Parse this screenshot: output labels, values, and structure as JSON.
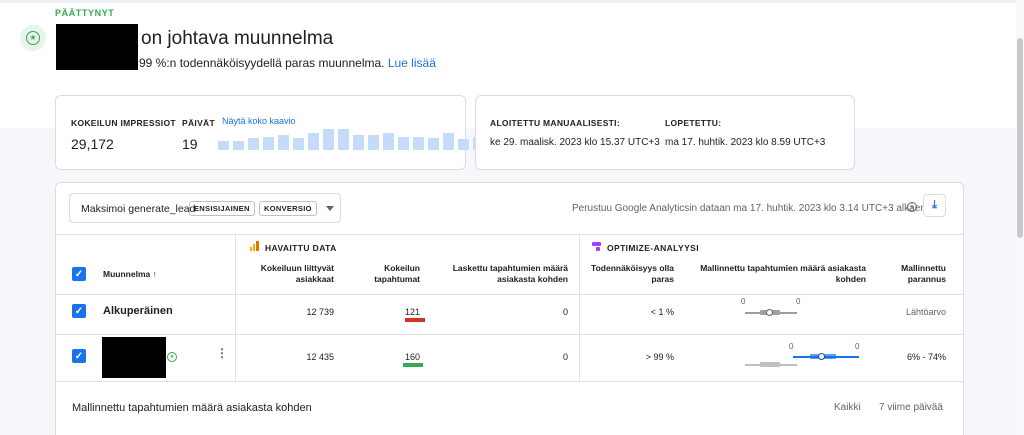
{
  "header": {
    "status": "PÄÄTTYNYT",
    "headline": "on johtava muunnelma",
    "subline": "99 %:n todennäköisyydellä paras muunnelma.",
    "learn_more": "Lue lisää"
  },
  "summary": {
    "impressions_label": "KOKEILUN IMPRESSIOT",
    "impressions_value": "29,172",
    "days_label": "PÄIVÄT",
    "days_value": "19",
    "show_chart_link": "Näytä koko kaavio",
    "days_chart_values": [
      0.4,
      0.4,
      0.55,
      0.6,
      0.7,
      0.55,
      0.75,
      0.95,
      0.95,
      0.7,
      0.7,
      0.75,
      0.6,
      0.6,
      0.55,
      0.75,
      0.5,
      0.6,
      0.75
    ],
    "started_label": "ALOITETTU MANUAALISESTI:",
    "started_value": "ke 29. maalisk. 2023 klo 15.37 UTC+3",
    "ended_label": "LOPETETTU:",
    "ended_value": "ma 17. huhtik. 2023 klo 8.59 UTC+3"
  },
  "toolbar": {
    "objective_label": "Maksimoi generate_lead",
    "chip_primary": "ENSISIJAINEN",
    "chip_conversion": "KONVERSIO",
    "based_on": "Perustuu Google Analyticsin dataan ma 17. huhtik. 2023 klo 3.14 UTC+3 alkaen.",
    "info_glyph": "i",
    "download_glyph": "⤓"
  },
  "table": {
    "observed_title": "HAVAITTU DATA",
    "optimize_title": "OPTIMIZE-ANALYYSI",
    "col_variant": "Muunnelma ↑",
    "col_users": [
      "Kokeiluun liittyvät",
      "asiakkaat"
    ],
    "col_events": [
      "Kokeilun",
      "tapahtumat"
    ],
    "col_events_per_user": [
      "Laskettu tapahtumien määrä",
      "asiakasta kohden"
    ],
    "col_probability": [
      "Todennäköisyys olla",
      "paras"
    ],
    "col_modeled_events": [
      "Mallinnettu tapahtumien määrä asiakasta",
      "kohden"
    ],
    "col_improvement": [
      "Mallinnettu",
      "parannus"
    ],
    "check_glyph": "✓",
    "rows": [
      {
        "name": "Alkuperäinen",
        "users": "12 739",
        "events": "121",
        "events_color": "#d93025",
        "per_user": "0",
        "probability": "< 1 %",
        "range_min": "0",
        "range_max": "0",
        "improvement": "Lähtöarvo"
      },
      {
        "name": "",
        "users": "12 435",
        "events": "160",
        "events_color": "#34a853",
        "per_user": "0",
        "probability": "> 99 %",
        "range_min": "0",
        "range_max": "0",
        "improvement": "6% - 74%"
      }
    ]
  },
  "footer": {
    "title": "Mallinnettu tapahtumien määrä asiakasta kohden",
    "option_all": "Kaikki",
    "option_7days": "7 viime päivää"
  },
  "colors": {
    "accent": "#1a73e8",
    "success": "#34a853",
    "danger": "#d93025",
    "optimize_purple": "#a142f4",
    "analytics_orange": "#f9ab00"
  }
}
